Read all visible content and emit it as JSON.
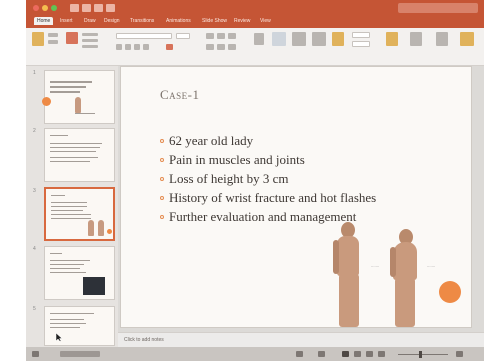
{
  "window": {
    "title": "",
    "accent_color": "#c55535"
  },
  "ribbon": {
    "tabs": [
      "Home",
      "Insert",
      "Draw",
      "Design",
      "Transitions",
      "Animations",
      "Slide Show",
      "Review",
      "View"
    ],
    "active_tab": "Home"
  },
  "thumbnails": {
    "count": 5,
    "selected": 3,
    "numbers": [
      "1",
      "2",
      "3",
      "4",
      "5"
    ]
  },
  "slide": {
    "title": "Case-1",
    "bullets": [
      "62 year old lady",
      "Pain in muscles and joints",
      "Loss of height by 3 cm",
      "History of wrist fracture and hot flashes",
      "Further evaluation and management"
    ],
    "accent_color": "#ee8a45"
  },
  "notes": {
    "placeholder": "Click to add notes"
  }
}
